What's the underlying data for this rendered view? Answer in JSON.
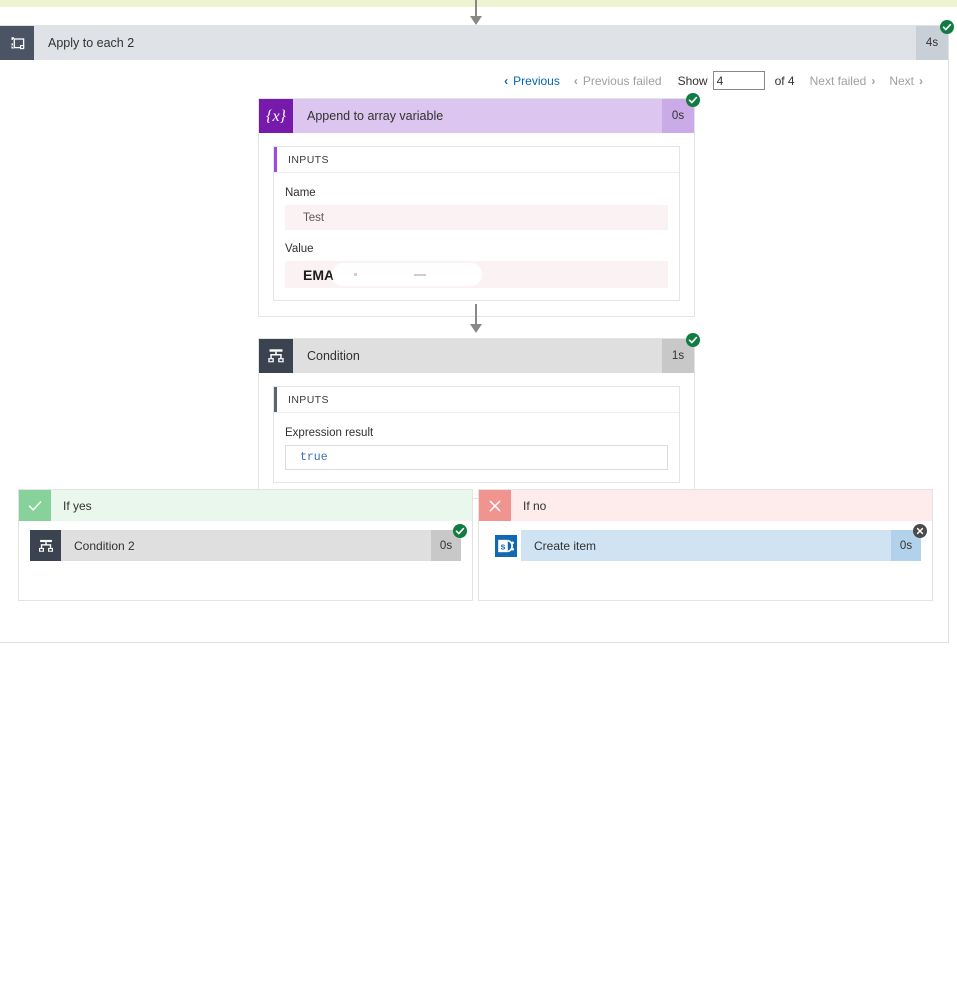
{
  "theme": {
    "top_band_color": "#eef3d2",
    "success_color": "#107c41",
    "skipped_color": "#4b4b4b",
    "link_color": "#0067b8",
    "variable_accent": "#7719aa",
    "condition_accent": "#3b4350",
    "sharepoint_accent": "#1268b3",
    "yes_accent": "#86d29a",
    "no_accent": "#f09490"
  },
  "scope": {
    "icon": "apply-to-each-icon",
    "title": "Apply to each 2",
    "duration": "4s",
    "status": "success"
  },
  "pager": {
    "previous_label": "Previous",
    "previous_failed_label": "Previous failed",
    "show_label": "Show",
    "show_value": "4",
    "of_label": "of 4",
    "next_failed_label": "Next failed",
    "next_label": "Next",
    "prev_chevron": "‹",
    "next_chevron": "›"
  },
  "actions": [
    {
      "id": "append-to-array-variable",
      "icon": "variable-braces-icon",
      "title": "Append to array variable",
      "duration": "0s",
      "status": "success",
      "panel_title": "INPUTS",
      "fields": [
        {
          "label": "Name",
          "value": "Test",
          "type": "readonly"
        },
        {
          "label": "Value",
          "value": "EMAIL",
          "type": "readonly-redacted"
        }
      ]
    },
    {
      "id": "condition",
      "icon": "condition-icon",
      "title": "Condition",
      "duration": "1s",
      "status": "success",
      "panel_title": "INPUTS",
      "fields": [
        {
          "label": "Expression result",
          "value": "true",
          "type": "code"
        }
      ]
    }
  ],
  "branches": [
    {
      "id": "if-yes",
      "icon": "check-icon",
      "label": "If yes",
      "child": {
        "id": "condition-2",
        "icon": "condition-icon",
        "title": "Condition 2",
        "duration": "0s",
        "status": "success"
      }
    },
    {
      "id": "if-no",
      "icon": "close-icon",
      "label": "If no",
      "child": {
        "id": "create-item",
        "icon": "sharepoint-icon",
        "title": "Create item",
        "duration": "0s",
        "status": "skipped"
      }
    }
  ]
}
